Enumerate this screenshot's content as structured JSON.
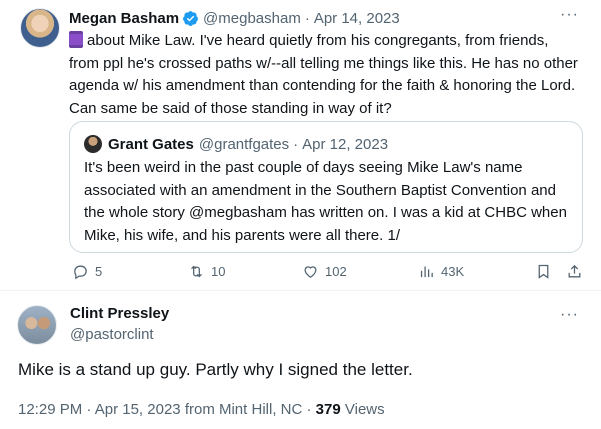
{
  "colors": {
    "text_primary": "#0f1419",
    "text_secondary": "#536471",
    "verified_blue": "#1d9bf0",
    "border": "#cfd9de"
  },
  "tweet": {
    "author_name": "Megan Basham",
    "handle": "@megbasham",
    "separator": "·",
    "date": "Apr 14, 2023",
    "more_label": "···",
    "text_emoji": "scroll-emoji",
    "text": "about Mike Law. I've heard quietly from his congregants, from friends, from ppl he's crossed paths w/--all telling me things like this. He has no other agenda w/ his amendment than contending for the faith & honoring the Lord. Can same be said of those standing in way of it?",
    "quote": {
      "author_name": "Grant Gates",
      "handle": "@grantfgates",
      "separator": "·",
      "date": "Apr 12, 2023",
      "text": "It's been weird in the past couple of days seeing Mike Law's name associated with an amendment in the Southern Baptist Convention and the whole story @megbasham has written on. I was a kid at CHBC when Mike, his wife, and his parents were all there. 1/"
    },
    "actions": {
      "replies": "5",
      "retweets": "10",
      "likes": "102",
      "views": "43K"
    }
  },
  "reply": {
    "author_name": "Clint Pressley",
    "handle": "@pastorclint",
    "more_label": "···",
    "text": "Mike is a stand up guy. Partly why I signed the letter.",
    "meta": {
      "time": "12:29 PM",
      "sep1": "·",
      "date": "Apr 15, 2023",
      "location": "from Mint Hill, NC",
      "sep2": "·",
      "views_count": "379",
      "views_label": "Views"
    }
  }
}
